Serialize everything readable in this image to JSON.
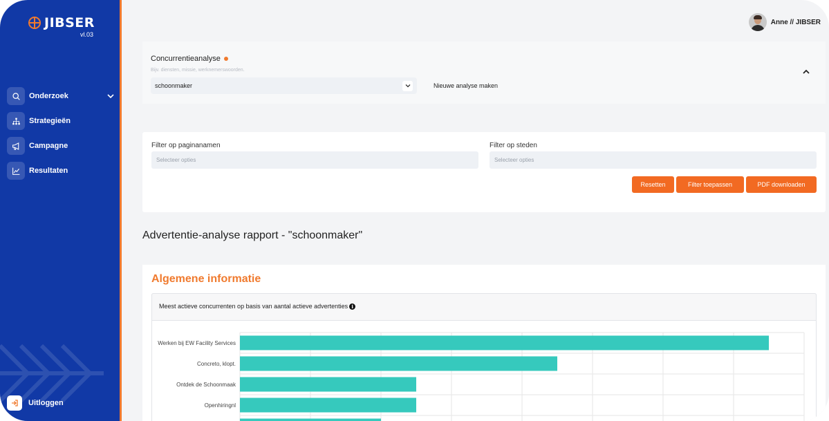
{
  "brand": {
    "name": "JIBSER",
    "version": "vl.03"
  },
  "sidebar": {
    "items": [
      {
        "label": "Onderzoek",
        "icon": "search-icon",
        "has_chevron": true
      },
      {
        "label": "Strategieën",
        "icon": "sitemap-icon",
        "has_chevron": false
      },
      {
        "label": "Campagne",
        "icon": "megaphone-icon",
        "has_chevron": false
      },
      {
        "label": "Resultaten",
        "icon": "chart-line-icon",
        "has_chevron": false
      }
    ],
    "logout_label": "Uitloggen"
  },
  "header": {
    "user_label": "Anne // JIBSER"
  },
  "analysis": {
    "title": "Concurrentieanalyse",
    "hint": "Bijv. diensten, missie, werknemerswoorden.",
    "selected": "schoonmaker",
    "new_label": "Nieuwe analyse maken"
  },
  "filters": {
    "pages_label": "Filter op paginanamen",
    "pages_placeholder": "Selecteer opties",
    "cities_label": "Filter op steden",
    "cities_placeholder": "Selecteer opties",
    "reset_label": "Resetten",
    "apply_label": "Filter toepassen",
    "pdf_label": "PDF downloaden"
  },
  "report": {
    "title": "Advertentie-analyse rapport - \"schoonmaker\"",
    "section_title": "Algemene informatie",
    "chart_caption": "Meest actieve concurrenten op basis van aantal actieve advertenties"
  },
  "colors": {
    "sidebar": "#1139a6",
    "accent": "#f07a2e",
    "button": "#f26a22",
    "bar": "#36c9bd"
  },
  "chart_data": {
    "type": "bar",
    "orientation": "horizontal",
    "title": "Meest actieve concurrenten op basis van aantal actieve advertenties",
    "categories": [
      "Werken bij EW Facility Services",
      "Concreto, klopt.",
      "Ontdek de Schoonmaak",
      "Openhiringnl",
      ""
    ],
    "values": [
      15,
      9,
      5,
      5,
      4
    ],
    "xlim": [
      0,
      16
    ],
    "grid": true
  }
}
